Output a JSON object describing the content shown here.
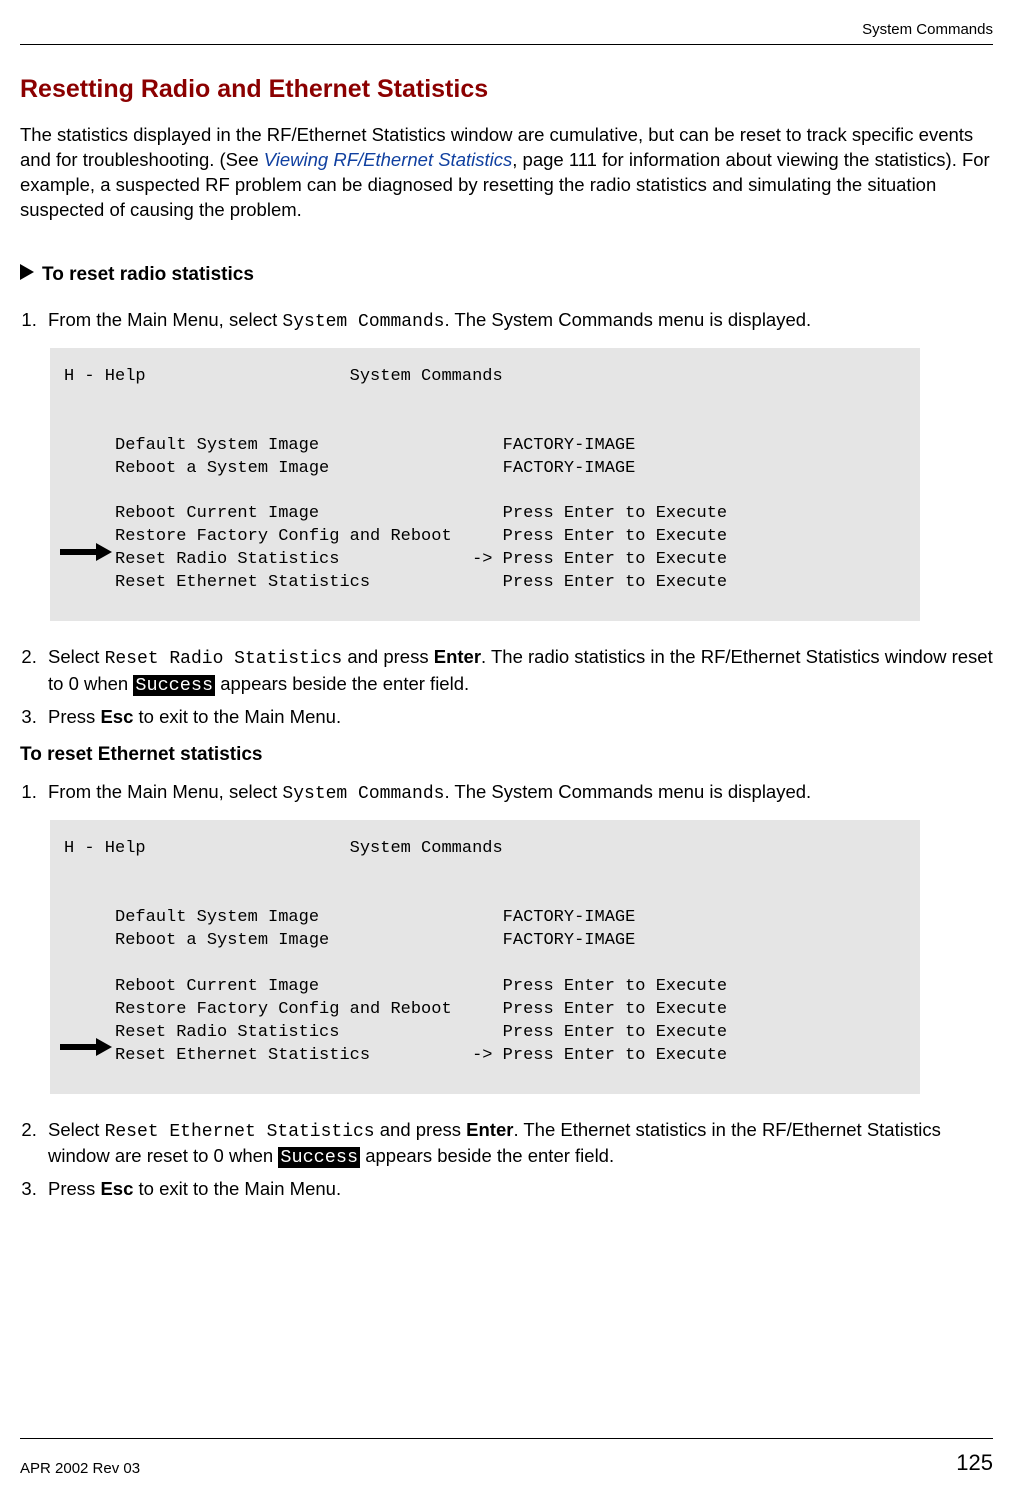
{
  "header": {
    "section": "System Commands"
  },
  "title": "Resetting Radio and Ethernet Statistics",
  "intro": {
    "part1": "The statistics displayed in the RF/Ethernet Statistics window are cumulative, but can be reset to track specific events and for troubleshooting. (See ",
    "xref": "Viewing RF/Ethernet Statistics",
    "part2": ", page 111 for information about viewing the statistics). For example, a suspected RF problem can be diagnosed by resetting the radio statistics and simulating the situation suspected of causing the problem."
  },
  "procA": {
    "heading": "To reset radio statistics",
    "step1_a": "From the Main Menu, select ",
    "step1_b": "System Commands",
    "step1_c": ". The System Commands menu is displayed.",
    "code": "H - Help                    System Commands\n\n\n     Default System Image                  FACTORY-IMAGE\n     Reboot a System Image                 FACTORY-IMAGE\n\n     Reboot Current Image                  Press Enter to Execute\n     Restore Factory Config and Reboot     Press Enter to Execute\n     Reset Radio Statistics             -> Press Enter to Execute\n     Reset Ethernet Statistics             Press Enter to Execute",
    "step2_a": "Select ",
    "step2_b": "Reset Radio Statistics",
    "step2_c": " and press ",
    "step2_d": "Enter",
    "step2_e": ". The radio statistics in the RF/Ethernet Statistics window reset to 0 when ",
    "step2_f": "Success",
    "step2_g": " appears beside the enter field.",
    "step3_a": "Press ",
    "step3_b": "Esc",
    "step3_c": " to exit to the Main Menu."
  },
  "procB": {
    "heading": "To reset Ethernet statistics",
    "step1_a": "From the Main Menu, select ",
    "step1_b": "System Commands",
    "step1_c": ". The System Commands menu is displayed.",
    "code": "H - Help                    System Commands\n\n\n     Default System Image                  FACTORY-IMAGE\n     Reboot a System Image                 FACTORY-IMAGE\n\n     Reboot Current Image                  Press Enter to Execute\n     Restore Factory Config and Reboot     Press Enter to Execute\n     Reset Radio Statistics                Press Enter to Execute\n     Reset Ethernet Statistics          -> Press Enter to Execute",
    "step2_a": "Select ",
    "step2_b": "Reset Ethernet Statistics",
    "step2_c": " and press ",
    "step2_d": "Enter",
    "step2_e": ". The Ethernet statistics in the RF/Ethernet Statistics window are reset to 0 when ",
    "step2_f": "Success",
    "step2_g": " appears beside the enter field.",
    "step3_a": "Press ",
    "step3_b": "Esc",
    "step3_c": " to exit to the Main Menu."
  },
  "footer": {
    "left": "APR 2002 Rev 03",
    "page": "125"
  }
}
